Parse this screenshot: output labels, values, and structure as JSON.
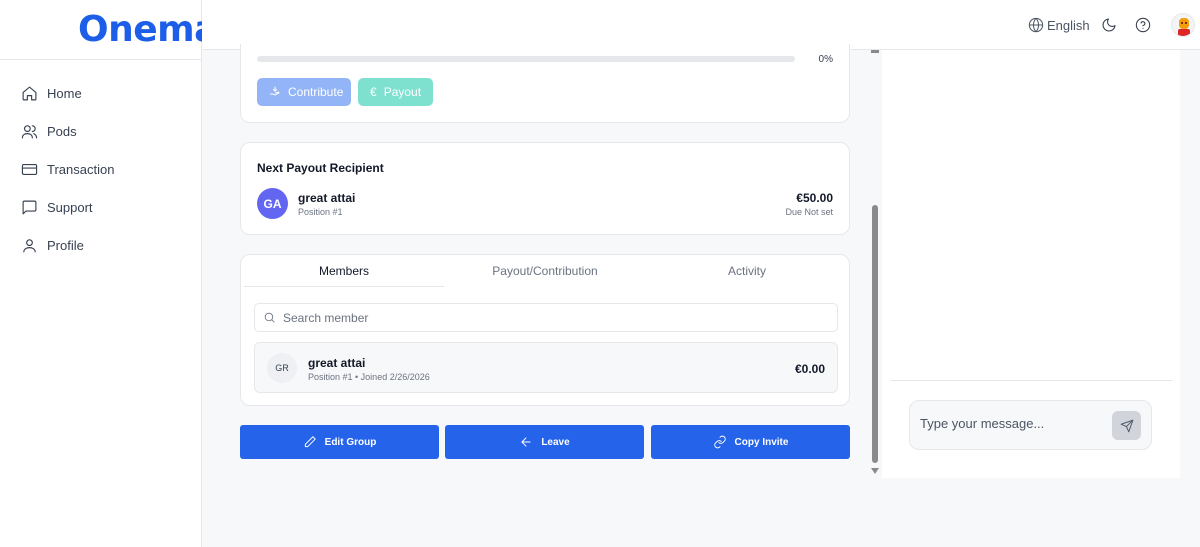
{
  "app": {
    "logo_text": "Onemai"
  },
  "sidebar": {
    "items": [
      {
        "label": "Home",
        "icon": "home-icon"
      },
      {
        "label": "Pods",
        "icon": "users-icon"
      },
      {
        "label": "Transaction",
        "icon": "credit-card-icon"
      },
      {
        "label": "Support",
        "icon": "message-square-icon"
      },
      {
        "label": "Profile",
        "icon": "user-icon"
      }
    ]
  },
  "header": {
    "language": "English",
    "icons": [
      "globe-icon",
      "moon-icon",
      "help-circle-icon",
      "avatar"
    ]
  },
  "progress": {
    "percent_label": "0%",
    "value": 0
  },
  "actions_top": {
    "contribute_label": "Contribute",
    "payout_label": "Payout",
    "payout_icon": "€"
  },
  "next_payout": {
    "title": "Next Payout Recipient",
    "initials": "GA",
    "name": "great attai",
    "position": "Position #1",
    "amount": "€50.00",
    "due": "Due Not set"
  },
  "tabs": [
    {
      "label": "Members",
      "active": true
    },
    {
      "label": "Payout/Contribution",
      "active": false
    },
    {
      "label": "Activity",
      "active": false
    }
  ],
  "members_search": {
    "placeholder": "Search member"
  },
  "members": [
    {
      "initials": "GR",
      "name": "great attai",
      "meta": "Position #1 • Joined 2/26/2026",
      "amount": "€0.00"
    }
  ],
  "group_actions": {
    "edit_label": "Edit Group",
    "leave_label": "Leave",
    "copy_label": "Copy Invite"
  },
  "chat": {
    "placeholder": "Type your message..."
  },
  "colors": {
    "brand": "#1d5ee8",
    "primary_button": "#2563eb",
    "ga_avatar": "#6366f1"
  }
}
